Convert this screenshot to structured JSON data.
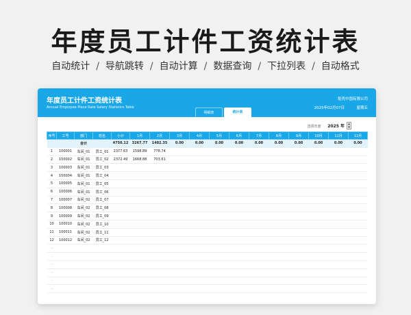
{
  "hero": {
    "title": "年度员工计件工资统计表",
    "features": [
      "自动统计",
      "导航跳转",
      "自动计算",
      "数据查询",
      "下拉列表",
      "自动格式"
    ],
    "separator": "/"
  },
  "app": {
    "title": "年度员工计件工资统计表",
    "subtitle": "Annual Employee Piece Rate Salary Statistics Table",
    "brand": "稻壳中国有限公司",
    "date": "2025年02月07日",
    "weekday": "星期五",
    "tabs": [
      "明细表",
      "统计表"
    ],
    "active_tab": "统计表"
  },
  "year_selector": {
    "label": "选择年度",
    "value": "2025 年",
    "up": "▲",
    "down": "▼"
  },
  "table": {
    "headers": [
      "序号",
      "工号",
      "部门",
      "姓名",
      "小计",
      "1月",
      "2月",
      "3月",
      "4月",
      "5月",
      "6月",
      "7月",
      "8月",
      "9月",
      "10月",
      "11月",
      "12月"
    ],
    "total_row": [
      "",
      "",
      "合计",
      "",
      "4750.12",
      "3267.77",
      "1482.35",
      "0.00",
      "0.00",
      "0.00",
      "0.00",
      "0.00",
      "0.00",
      "0.00",
      "0.00",
      "0.00",
      "0.00"
    ],
    "rows": [
      [
        "1",
        "100001",
        "车间_01",
        "员工_01",
        "2377.63",
        "1598.89",
        "778.74",
        "",
        "",
        "",
        "",
        "",
        "",
        "",
        "",
        "",
        ""
      ],
      [
        "2",
        "100002",
        "车间_01",
        "员工_02",
        "2372.49",
        "1668.88",
        "703.61",
        "",
        "",
        "",
        "",
        "",
        "",
        "",
        "",
        "",
        ""
      ],
      [
        "3",
        "100003",
        "车间_01",
        "员工_03",
        "",
        "",
        "",
        "",
        "",
        "",
        "",
        "",
        "",
        "",
        "",
        "",
        ""
      ],
      [
        "4",
        "100004",
        "车间_01",
        "员工_04",
        "",
        "",
        "",
        "",
        "",
        "",
        "",
        "",
        "",
        "",
        "",
        "",
        ""
      ],
      [
        "5",
        "100005",
        "车间_01",
        "员工_05",
        "",
        "",
        "",
        "",
        "",
        "",
        "",
        "",
        "",
        "",
        "",
        "",
        ""
      ],
      [
        "6",
        "100006",
        "车间_01",
        "员工_06",
        "",
        "",
        "",
        "",
        "",
        "",
        "",
        "",
        "",
        "",
        "",
        "",
        ""
      ],
      [
        "7",
        "100007",
        "车间_02",
        "员工_07",
        "",
        "",
        "",
        "",
        "",
        "",
        "",
        "",
        "",
        "",
        "",
        "",
        ""
      ],
      [
        "8",
        "100008",
        "车间_02",
        "员工_08",
        "",
        "",
        "",
        "",
        "",
        "",
        "",
        "",
        "",
        "",
        "",
        "",
        ""
      ],
      [
        "9",
        "100009",
        "车间_02",
        "员工_09",
        "",
        "",
        "",
        "",
        "",
        "",
        "",
        "",
        "",
        "",
        "",
        "",
        ""
      ],
      [
        "10",
        "100010",
        "车间_02",
        "员工_10",
        "",
        "",
        "",
        "",
        "",
        "",
        "",
        "",
        "",
        "",
        "",
        "",
        ""
      ],
      [
        "11",
        "100011",
        "车间_02",
        "员工_11",
        "",
        "",
        "",
        "",
        "",
        "",
        "",
        "",
        "",
        "",
        "",
        "",
        ""
      ],
      [
        "12",
        "100012",
        "车间_02",
        "员工_12",
        "",
        "",
        "",
        "",
        "",
        "",
        "",
        "",
        "",
        "",
        "",
        "",
        ""
      ],
      [
        "-",
        "",
        "",
        "",
        "",
        "",
        "",
        "",
        "",
        "",
        "",
        "",
        "",
        "",
        "",
        "",
        ""
      ],
      [
        "-",
        "",
        "",
        "",
        "",
        "",
        "",
        "",
        "",
        "",
        "",
        "",
        "",
        "",
        "",
        "",
        ""
      ],
      [
        "-",
        "",
        "",
        "",
        "",
        "",
        "",
        "",
        "",
        "",
        "",
        "",
        "",
        "",
        "",
        "",
        ""
      ],
      [
        "-",
        "",
        "",
        "",
        "",
        "",
        "",
        "",
        "",
        "",
        "",
        "",
        "",
        "",
        "",
        "",
        ""
      ],
      [
        "-",
        "",
        "",
        "",
        "",
        "",
        "",
        "",
        "",
        "",
        "",
        "",
        "",
        "",
        "",
        "",
        ""
      ],
      [
        "-",
        "",
        "",
        "",
        "",
        "",
        "",
        "",
        "",
        "",
        "",
        "",
        "",
        "",
        "",
        "",
        ""
      ]
    ]
  },
  "colors": {
    "accent": "#1aa7e8",
    "total_row_bg": "#e3f3fc"
  }
}
